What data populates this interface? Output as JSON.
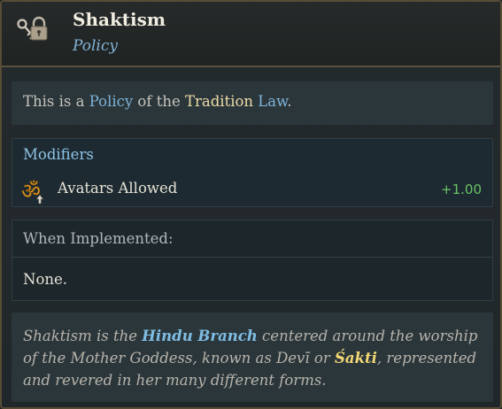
{
  "header": {
    "title": "Shaktism",
    "subtitle": "Policy",
    "icon": "lock-and-key-icon"
  },
  "description": {
    "part1": "This is a ",
    "kw1": "Policy",
    "part2": " of the ",
    "kw2": "Tradition",
    "part3": " ",
    "kw3": "Law",
    "part4": "."
  },
  "modifiers": {
    "heading": "Modifiers",
    "items": [
      {
        "icon": "om-symbol-icon",
        "label": "Avatars Allowed",
        "value": "+1.00"
      }
    ]
  },
  "implemented": {
    "heading": "When Implemented:",
    "value": "None."
  },
  "flavor": {
    "t1": "Shaktism is the ",
    "kw1": "Hindu Branch",
    "t2": " centered around the worship of the Mother Goddess, known as Devī or ",
    "kw2": "Śakti",
    "t3": ", represented and revered in her many different forms."
  },
  "colors": {
    "accent_blue": "#7fb3d8",
    "accent_gold": "#eddca7",
    "positive_green": "#69c266",
    "frame_border": "#574c35"
  }
}
